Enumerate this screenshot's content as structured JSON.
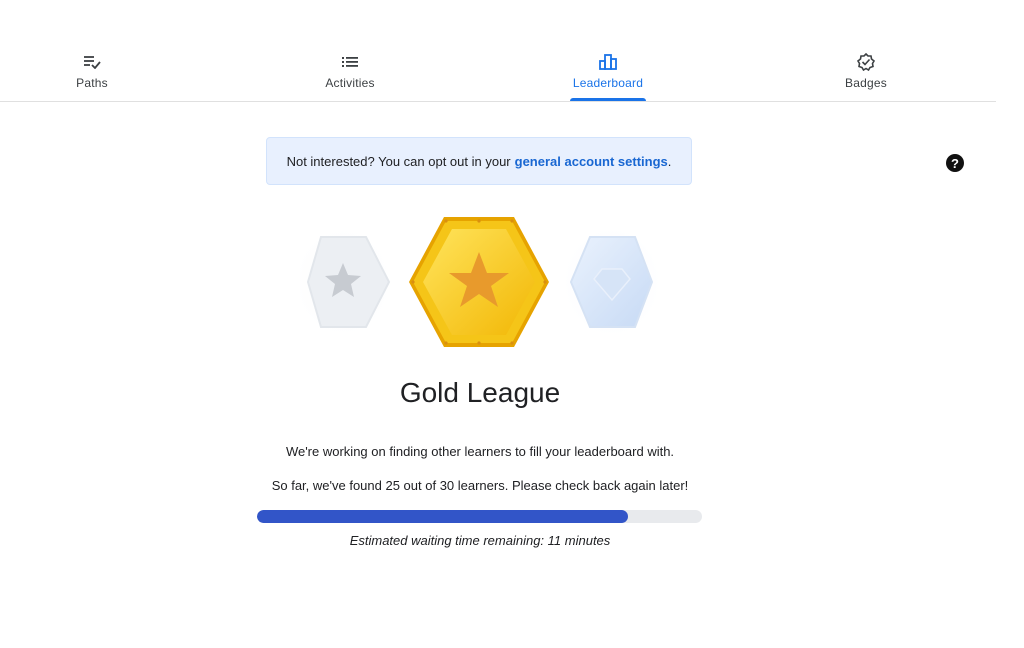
{
  "tabs": [
    {
      "label": "Paths",
      "icon": "playlist-check-icon",
      "active": false
    },
    {
      "label": "Activities",
      "icon": "list-icon",
      "active": false
    },
    {
      "label": "Leaderboard",
      "icon": "leaderboard-icon",
      "active": true
    },
    {
      "label": "Badges",
      "icon": "verified-badge-icon",
      "active": false
    }
  ],
  "notice": {
    "text": "Not interested? You can opt out in your",
    "link": "general account settings",
    "suffix": "."
  },
  "help": {
    "glyph": "?",
    "icon": "help-icon"
  },
  "league": {
    "title": "Gold League",
    "message": "We're working on finding other learners to fill your leaderboard with.",
    "progress_text": "So far, we've found 25 out of 30 learners. Please check back again later!",
    "found": 25,
    "target": 30,
    "eta": "Estimated waiting time remaining: 11 minutes"
  },
  "colors": {
    "accent": "#1a73e8",
    "progress": "#3255c8",
    "gold": "#f5c518",
    "notice_bg": "#e8f0fe"
  }
}
